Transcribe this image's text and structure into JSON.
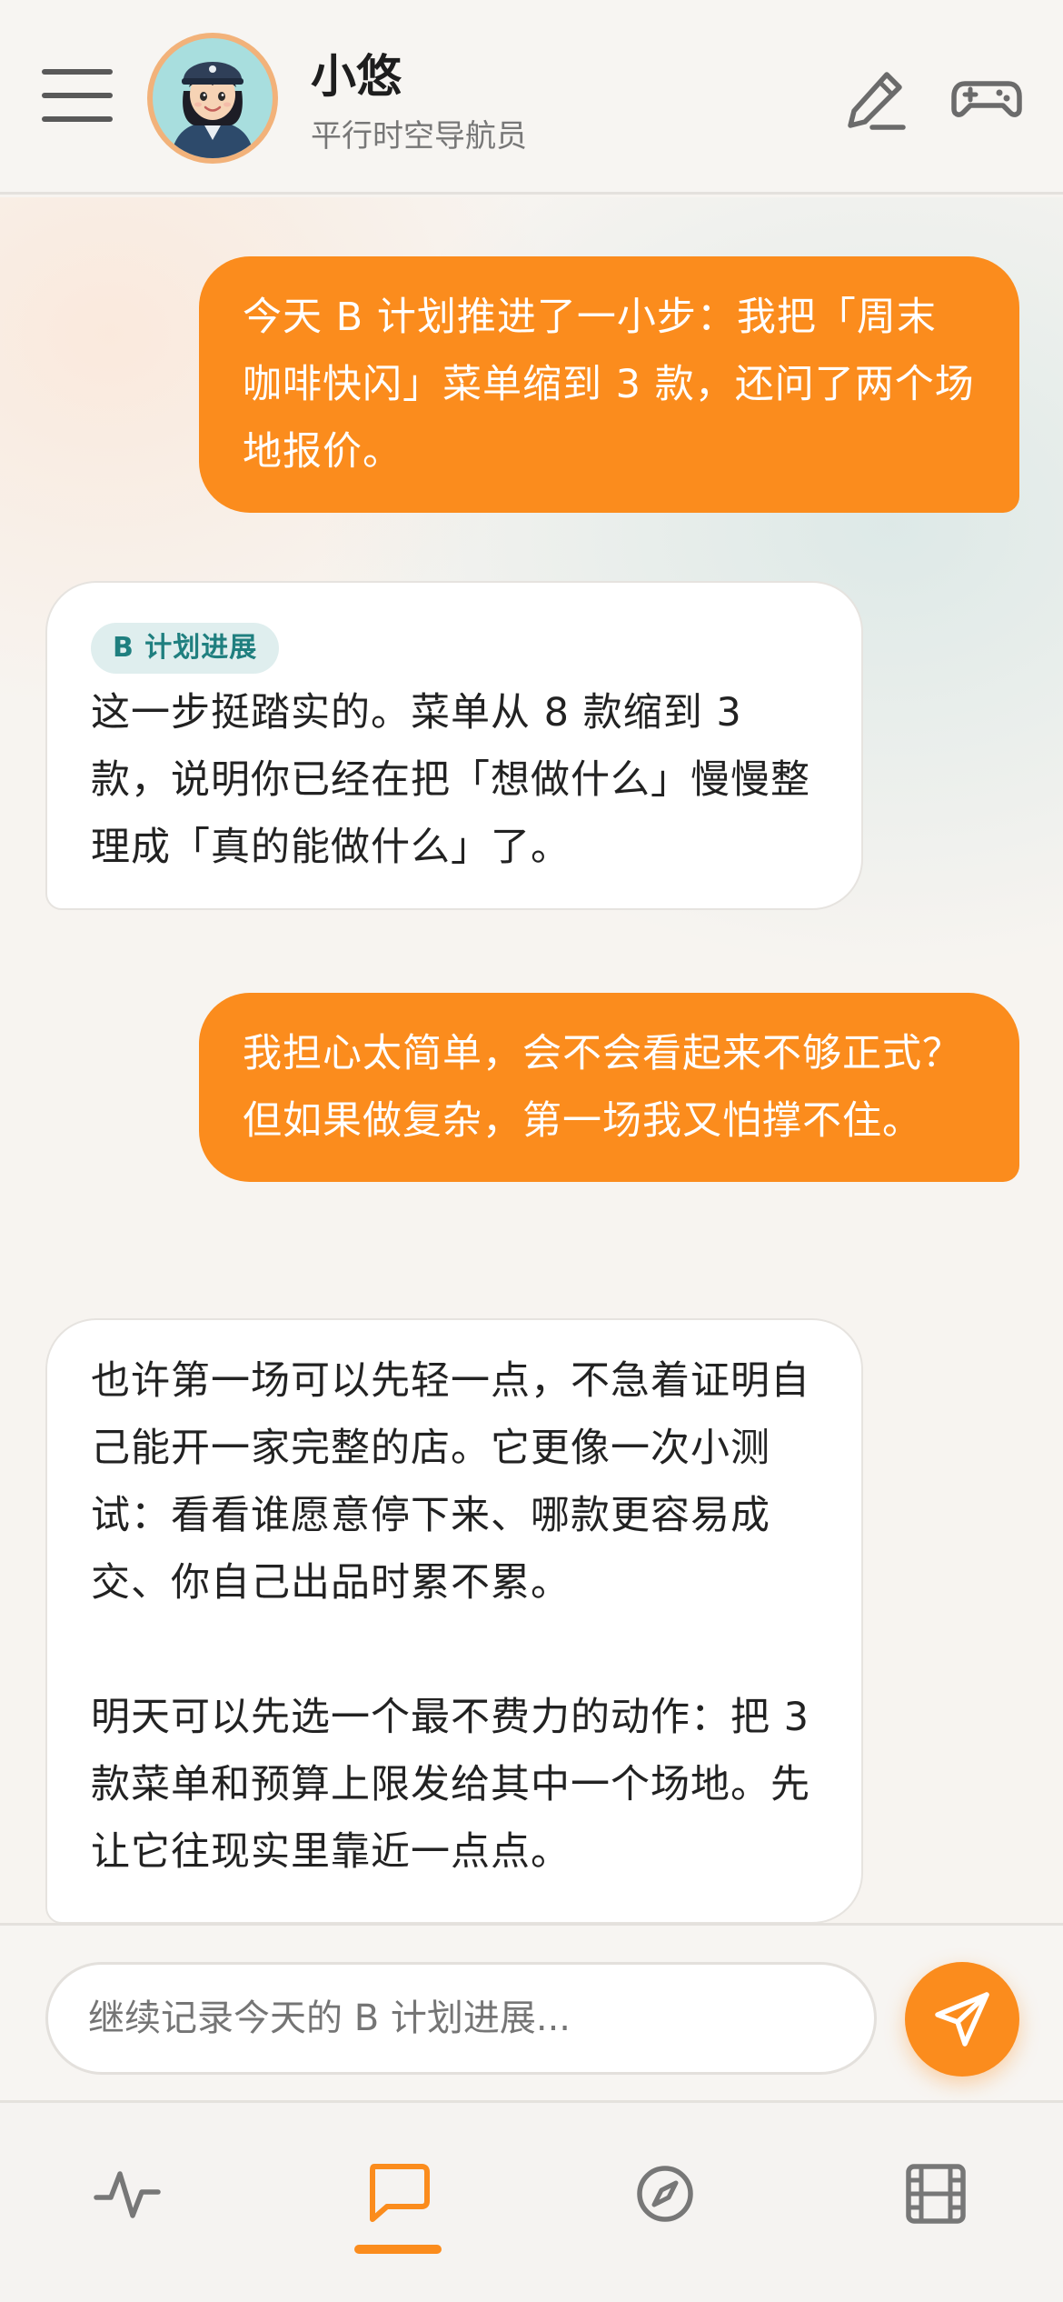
{
  "header": {
    "title": "小悠",
    "subtitle": "平行时空导航员"
  },
  "messages": [
    {
      "role": "user",
      "text": "今天 B 计划推进了一小步：我把「周末咖啡快闪」菜单缩到 3 款，还问了两个场地报价。"
    },
    {
      "role": "assistant",
      "tag": "B 计划进展",
      "text": "这一步挺踏实的。菜单从 8 款缩到 3 款，说明你已经在把「想做什么」慢慢整理成「真的能做什么」了。"
    },
    {
      "role": "user",
      "text": "我担心太简单，会不会看起来不够正式？但如果做复杂，第一场我又怕撑不住。"
    },
    {
      "role": "assistant",
      "paragraphs": [
        "也许第一场可以先轻一点，不急着证明自己能开一家完整的店。它更像一次小测试：看看谁愿意停下来、哪款更容易成交、你自己出品时累不累。",
        "明天可以先选一个最不费力的动作：把 3 款菜单和预算上限发给其中一个场地。先让它往现实里靠近一点点。"
      ]
    }
  ],
  "composer": {
    "placeholder": "继续记录今天的 B 计划进展..."
  },
  "tabs": [
    {
      "icon": "activity-icon",
      "active": false
    },
    {
      "icon": "chat-icon",
      "active": true
    },
    {
      "icon": "compass-icon",
      "active": false
    },
    {
      "icon": "film-icon",
      "active": false
    }
  ],
  "colors": {
    "accent": "#fb8c1d",
    "tag_bg": "#dfeeee",
    "tag_text": "#1f7f7f",
    "icon_gray": "#6b6b6b"
  }
}
